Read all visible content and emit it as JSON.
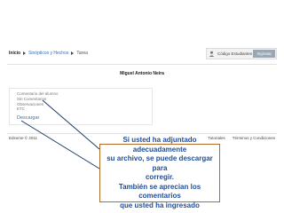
{
  "breadcrumb": {
    "home": "Inicio",
    "course": "Sinópticos y Hechos",
    "current": "Tarea"
  },
  "code_box": {
    "label": "Código Estudiantes",
    "button": "Ingresar"
  },
  "student_name": "Miguel Antonio Neira",
  "comments": {
    "lines": [
      "Comentario del alumno",
      "Sin Comentarios",
      "Observaciones",
      "ETC"
    ],
    "download": "Descargar"
  },
  "footer": {
    "copyright": "Edsome © 2011",
    "links": [
      "Tutoriales",
      "Términos y Condiciones"
    ]
  },
  "callout": {
    "text": "Si usted ha adjuntado adecuadamente\nsu archivo, se puede descargar para\ncorregir.\nTambién se aprecian los comentarios\nque usted ha ingresado"
  },
  "colors": {
    "link": "#3a6fb0",
    "callout_text": "#1f4e99",
    "callout_border": "#b06a2c",
    "button_bg": "#9aa7b4"
  }
}
